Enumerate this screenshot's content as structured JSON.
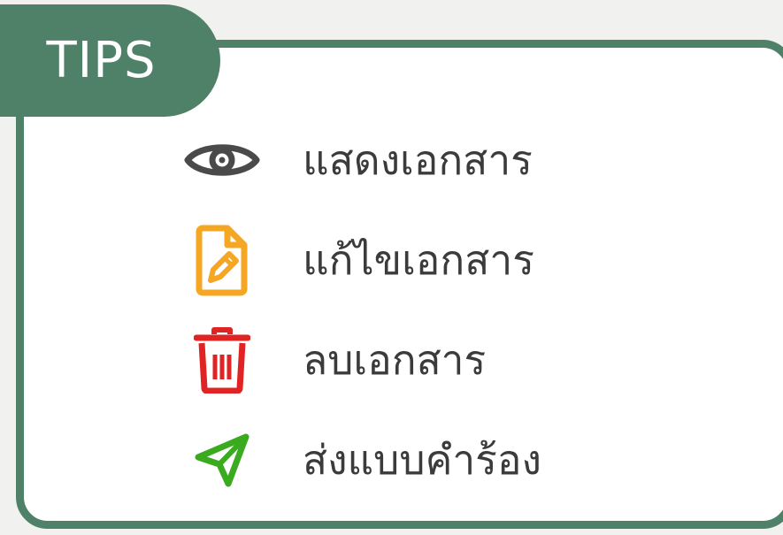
{
  "panel": {
    "title": "TIPS",
    "border_color": "#4f8068",
    "background": "#ffffff"
  },
  "tips": [
    {
      "icon": "eye-icon",
      "color": "#4a4a4a",
      "label": "แสดงเอกสาร"
    },
    {
      "icon": "document-edit-icon",
      "color": "#f5a623",
      "label": "แก้ไขเอกสาร"
    },
    {
      "icon": "trash-icon",
      "color": "#e02424",
      "label": "ลบเอกสาร"
    },
    {
      "icon": "send-icon",
      "color": "#3aaa1e",
      "label": "ส่งแบบคำร้อง"
    }
  ]
}
